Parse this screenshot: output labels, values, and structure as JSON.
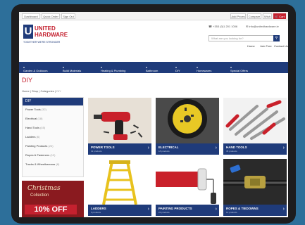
{
  "topbar": {
    "tabs": [
      "Dashboard",
      "Quick Order",
      "Sign Out"
    ],
    "right_items": [
      "Add Prices",
      "Compare",
      "Wish"
    ],
    "cart_label": "Cart"
  },
  "logo": {
    "brand": "UNITED HARDWARE",
    "tagline": "TOGETHER WE'RE STRONGER"
  },
  "contact": {
    "phone": "+353 (0)1 201 1006",
    "email": "info@unitedhardware.ie"
  },
  "search": {
    "placeholder": "What are you looking for?",
    "icon": "search-icon"
  },
  "toplinks": [
    "Home",
    "Join Free",
    "Contact Us"
  ],
  "nav": [
    "Garden & Outdoors",
    "Build Materials",
    "Heating & Plumbing",
    "Bathroom",
    "DIY",
    "Homewares",
    "Special Offers"
  ],
  "page": {
    "title": "DIY",
    "breadcrumb": [
      "Home",
      "Shop",
      "Categories",
      "DIY"
    ]
  },
  "sidebar": {
    "heading": "DIY",
    "items": [
      {
        "label": "Power Tools",
        "count": "(32)"
      },
      {
        "label": "Electrical",
        "count": "(18)"
      },
      {
        "label": "Hand Tools",
        "count": "(45)"
      },
      {
        "label": "Ladders",
        "count": "(6)"
      },
      {
        "label": "Painting Products",
        "count": "(24)"
      },
      {
        "label": "Ropes & Fasteners",
        "count": "(12)"
      },
      {
        "label": "Tracks & Wheelbarrows",
        "count": "(8)"
      }
    ]
  },
  "banner": {
    "line1": "Christmas",
    "line2": "Collection",
    "line3": "10% OFF"
  },
  "tiles": [
    {
      "title": "POWER TOOLS",
      "sub": "32 products"
    },
    {
      "title": "ELECTRICAL",
      "sub": "18 products"
    },
    {
      "title": "HAND TOOLS",
      "sub": "45 products"
    },
    {
      "title": "LADDERS",
      "sub": "6 products"
    },
    {
      "title": "PAINTING PRODUCTS",
      "sub": "24 products"
    },
    {
      "title": "ROPES & TIEDOWNS",
      "sub": "12 products"
    }
  ],
  "colors": {
    "navy": "#1f3b7a",
    "red": "#c4212f",
    "frame": "#1d1d1f",
    "background": "#2d6f9a"
  }
}
